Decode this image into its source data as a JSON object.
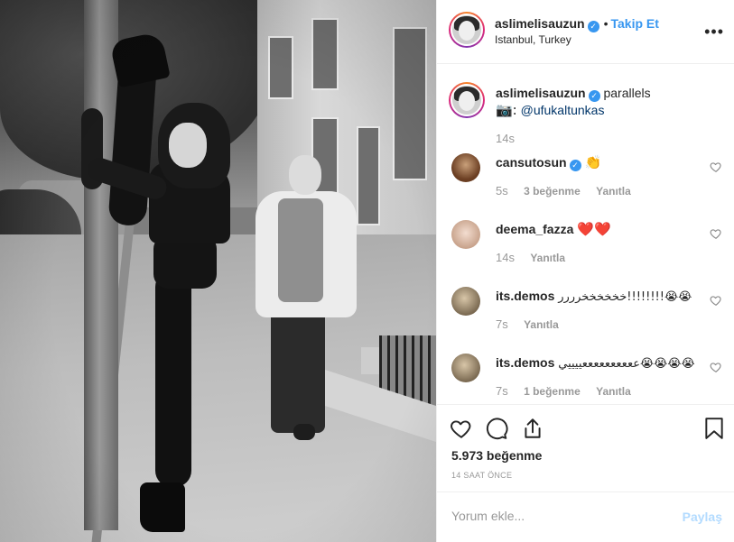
{
  "post": {
    "photo_alt": "",
    "author": {
      "username": "aslimelisauzun",
      "verified_icon": "verified-badge-icon",
      "follow_label": "Takip Et",
      "location": "Istanbul, Turkey"
    },
    "more_icon": "more-options-icon",
    "caption": {
      "username": "aslimelisauzun",
      "text": "parallels",
      "camera_emoji": "📷:",
      "mention": "@ufukaltunkas",
      "time": "14s"
    },
    "comments": [
      {
        "username": "cansutosun",
        "verified": true,
        "text": "👏",
        "time": "5s",
        "likes": "3 beğenme",
        "reply": "Yanıtla"
      },
      {
        "username": "deema_fazza",
        "verified": false,
        "text": "❤️❤️",
        "time": "14s",
        "likes": "",
        "reply": "Yanıtla"
      },
      {
        "username": "its.demos",
        "verified": false,
        "text": "خخخخخخرررر!!!!!!!!😭😭",
        "time": "7s",
        "likes": "",
        "reply": "Yanıtla"
      },
      {
        "username": "its.demos",
        "verified": false,
        "text": "ععععععععععييييي😭😭😭😭",
        "time": "7s",
        "likes": "1 beğenme",
        "reply": "Yanıtla"
      }
    ],
    "actions": {
      "like_icon": "heart-icon",
      "comment_icon": "comment-icon",
      "share_icon": "share-icon",
      "save_icon": "bookmark-icon"
    },
    "likes": "5.973 beğenme",
    "time_ago": "14 SAAT ÖNCE",
    "add_comment": {
      "placeholder": "Yorum ekle...",
      "post_label": "Paylaş"
    },
    "colors": {
      "link_blue": "#3897f0",
      "post_disabled": "#b3dbff",
      "muted": "#999999",
      "text": "#262626"
    }
  }
}
